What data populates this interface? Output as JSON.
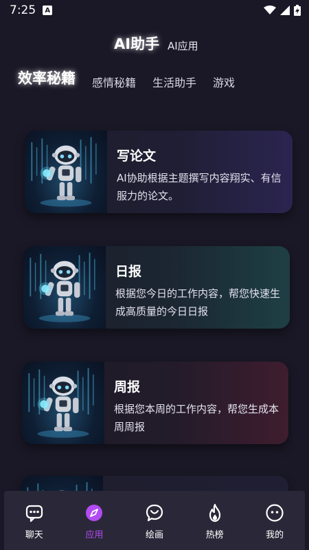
{
  "status": {
    "time": "7:25",
    "badge": "A"
  },
  "header": {
    "title": "AI助手",
    "subtitle": "AI应用"
  },
  "tabs": [
    {
      "label": "效率秘籍",
      "active": true
    },
    {
      "label": "感情秘籍",
      "active": false
    },
    {
      "label": "生活助手",
      "active": false
    },
    {
      "label": "游戏",
      "active": false
    }
  ],
  "cards": [
    {
      "title": "写论文",
      "desc": "AI协助根据主题撰写内容翔实、有信服力的论文。",
      "image": "robot-icon"
    },
    {
      "title": "日报",
      "desc": "根据您今日的工作内容，帮您快速生成高质量的今日日报",
      "image": "robot-icon"
    },
    {
      "title": "周报",
      "desc": "根据您本周的工作内容，帮您生成本周周报",
      "image": "robot-icon"
    },
    {
      "title": "",
      "desc": "",
      "image": "robot-icon"
    }
  ],
  "nav": [
    {
      "label": "聊天",
      "icon": "chat-icon",
      "active": false
    },
    {
      "label": "应用",
      "icon": "compass-icon",
      "active": true
    },
    {
      "label": "绘画",
      "icon": "heart-chat-icon",
      "active": false
    },
    {
      "label": "热榜",
      "icon": "flame-icon",
      "active": false
    },
    {
      "label": "我的",
      "icon": "face-icon",
      "active": false
    }
  ],
  "colors": {
    "background": "#1a1826",
    "accent": "#b34bf2",
    "nav_bg": "#2a2838"
  }
}
